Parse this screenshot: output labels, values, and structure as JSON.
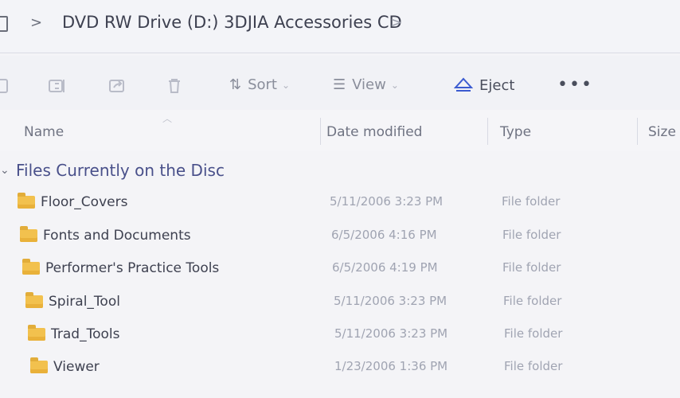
{
  "breadcrumb": {
    "path_title": "DVD RW Drive (D:) 3DJIA Accessories CD",
    "separator": ">"
  },
  "toolbar": {
    "sort_label": "Sort",
    "view_label": "View",
    "eject_label": "Eject",
    "more_label": "•••"
  },
  "columns": {
    "name": "Name",
    "date_modified": "Date modified",
    "type": "Type",
    "size": "Size"
  },
  "group": {
    "label": "Files Currently on the Disc"
  },
  "files": [
    {
      "name": "Floor_Covers",
      "date": "5/11/2006 3:23 PM",
      "type": "File folder"
    },
    {
      "name": "Fonts and Documents",
      "date": "6/5/2006 4:16 PM",
      "type": "File folder"
    },
    {
      "name": "Performer's Practice Tools",
      "date": "6/5/2006 4:19 PM",
      "type": "File folder"
    },
    {
      "name": "Spiral_Tool",
      "date": "5/11/2006 3:23 PM",
      "type": "File folder"
    },
    {
      "name": "Trad_Tools",
      "date": "5/11/2006 3:23 PM",
      "type": "File folder"
    },
    {
      "name": "Viewer",
      "date": "1/23/2006 1:36 PM",
      "type": "File folder"
    }
  ]
}
